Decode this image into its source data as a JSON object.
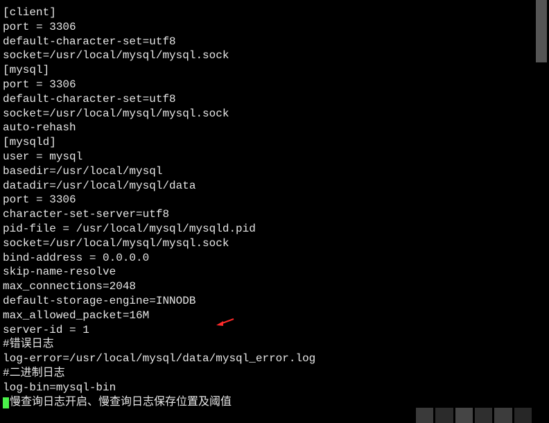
{
  "config_lines": [
    "[client]",
    "port = 3306",
    "default-character-set=utf8",
    "socket=/usr/local/mysql/mysql.sock",
    "",
    "[mysql]",
    "port = 3306",
    "default-character-set=utf8",
    "socket=/usr/local/mysql/mysql.sock",
    "auto-rehash",
    "",
    "[mysqld]",
    "user = mysql",
    "basedir=/usr/local/mysql",
    "datadir=/usr/local/mysql/data",
    "port = 3306",
    "character-set-server=utf8",
    "pid-file = /usr/local/mysql/mysqld.pid",
    "socket=/usr/local/mysql/mysql.sock",
    "bind-address = 0.0.0.0",
    "skip-name-resolve",
    "max_connections=2048",
    "default-storage-engine=INNODB",
    "max_allowed_packet=16M",
    "server-id = 1",
    "#错误日志",
    "log-error=/usr/local/mysql/data/mysql_error.log",
    "#二进制日志",
    "log-bin=mysql-bin"
  ],
  "last_line_prefix": "#",
  "last_line_text": "慢查询日志开启、慢查询日志保存位置及阈值",
  "arrow_color": "#ff2a2a"
}
